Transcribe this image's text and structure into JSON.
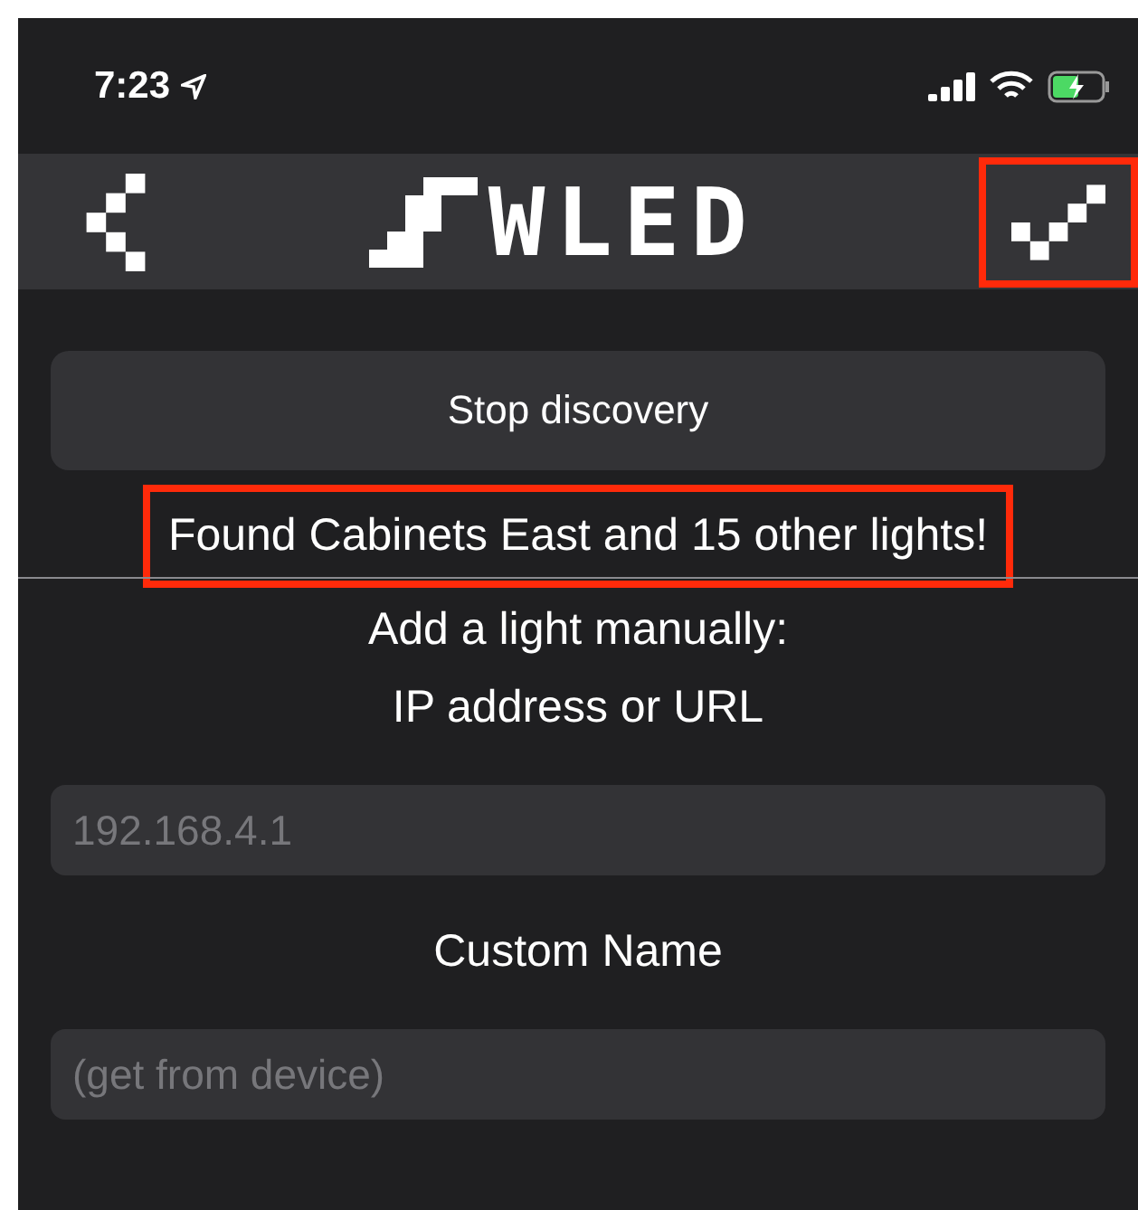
{
  "status_bar": {
    "time": "7:23"
  },
  "nav": {
    "title": "WLED",
    "highlight_confirm": true
  },
  "stop_button": {
    "label": "Stop discovery"
  },
  "discovery_message": {
    "text": "Found Cabinets East and 15 other lights!",
    "highlighted": true
  },
  "manual": {
    "heading": "Add a light manually:",
    "address_label": "IP address or URL",
    "address_placeholder": "192.168.4.1",
    "name_label": "Custom Name",
    "name_placeholder": "(get from device)"
  }
}
